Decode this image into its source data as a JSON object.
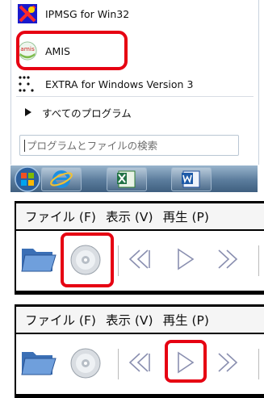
{
  "start_menu": {
    "items": [
      {
        "label": "IPMSG for Win32",
        "icon": "ipmsg-icon"
      },
      {
        "label": "AMIS",
        "icon": "amis-icon",
        "icon_text": "amis"
      },
      {
        "label": "EXTRA for Windows Version 3",
        "icon": "braille-dots-icon"
      }
    ],
    "all_programs": "すべてのプログラム",
    "search_placeholder": "プログラムとファイルの検索"
  },
  "taskbar": {
    "buttons": [
      "start-orb",
      "internet-explorer-icon",
      "excel-icon",
      "word-icon"
    ]
  },
  "players": [
    {
      "menu": [
        "ファイル (F)",
        "表示 (V)",
        "再生 (P)"
      ],
      "highlighted": "cd-button"
    },
    {
      "menu": [
        "ファイル (F)",
        "表示 (V)",
        "再生 (P)"
      ],
      "highlighted": "play-button"
    }
  ],
  "colors": {
    "highlight": "#e60012",
    "taskbar": "#5b7c9c"
  }
}
